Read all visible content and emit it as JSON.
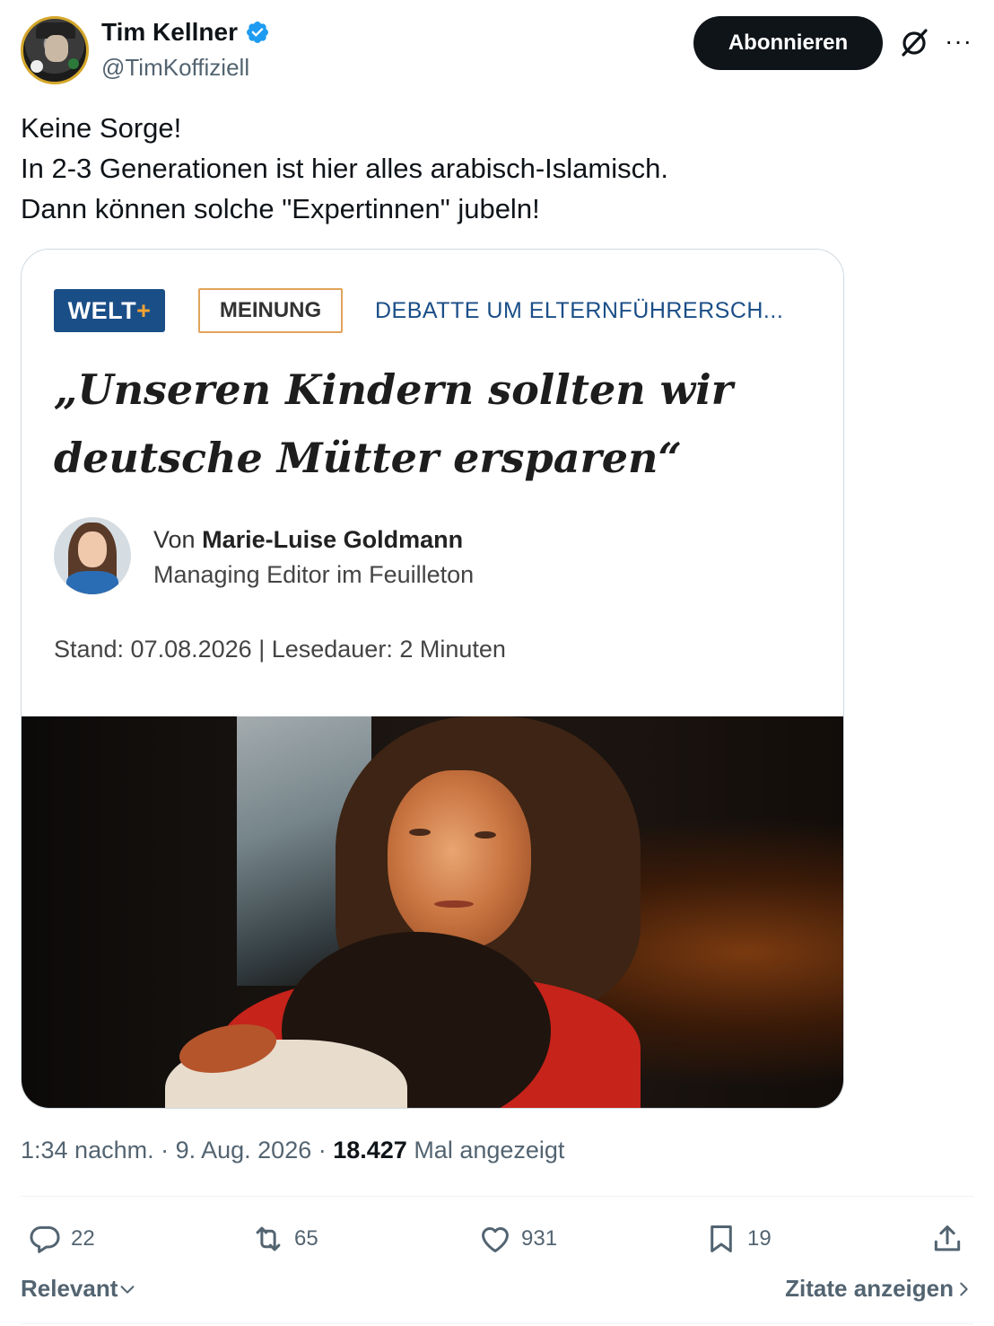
{
  "author": {
    "name": "Tim Kellner",
    "handle": "@TimKoffiziell",
    "verified": true
  },
  "header": {
    "subscribe_label": "Abonnieren",
    "grok_icon": "grok-icon",
    "more_icon": "more-icon"
  },
  "tweet": {
    "lines": [
      "Keine Sorge!",
      "In 2-3 Generationen ist hier alles arabisch-Islamisch.",
      "Dann können solche \"Expertinnen\" jubeln!"
    ]
  },
  "card": {
    "logo_text": "WELT",
    "logo_plus": "+",
    "category": "MEINUNG",
    "topic": "DEBATTE UM ELTERNFÜHRERSCH...",
    "headline_lines": [
      "„Unseren Kindern sollten wir",
      "deutsche Mütter ersparen“"
    ],
    "by_prefix": "Von",
    "author_name": "Marie-Luise Goldmann",
    "author_role": "Managing Editor im Feuilleton",
    "meta": "Stand: 07.08.2026  |  Lesedauer: 2 Minuten"
  },
  "meta": {
    "time": "1:34 nachm. · 9. Aug. 2026 · ",
    "views": "18.427",
    "views_label": " Mal angezeigt"
  },
  "actions": {
    "replies": "22",
    "retweets": "65",
    "likes": "931",
    "bookmarks": "19"
  },
  "footer": {
    "sort_label": "Relevant",
    "quotes_label": "Zitate anzeigen"
  },
  "colors": {
    "accent": "#1d9bf0",
    "text": "#0f1419",
    "muted": "#536471",
    "welt_blue": "#1a4e87",
    "welt_orange": "#f4a334"
  }
}
